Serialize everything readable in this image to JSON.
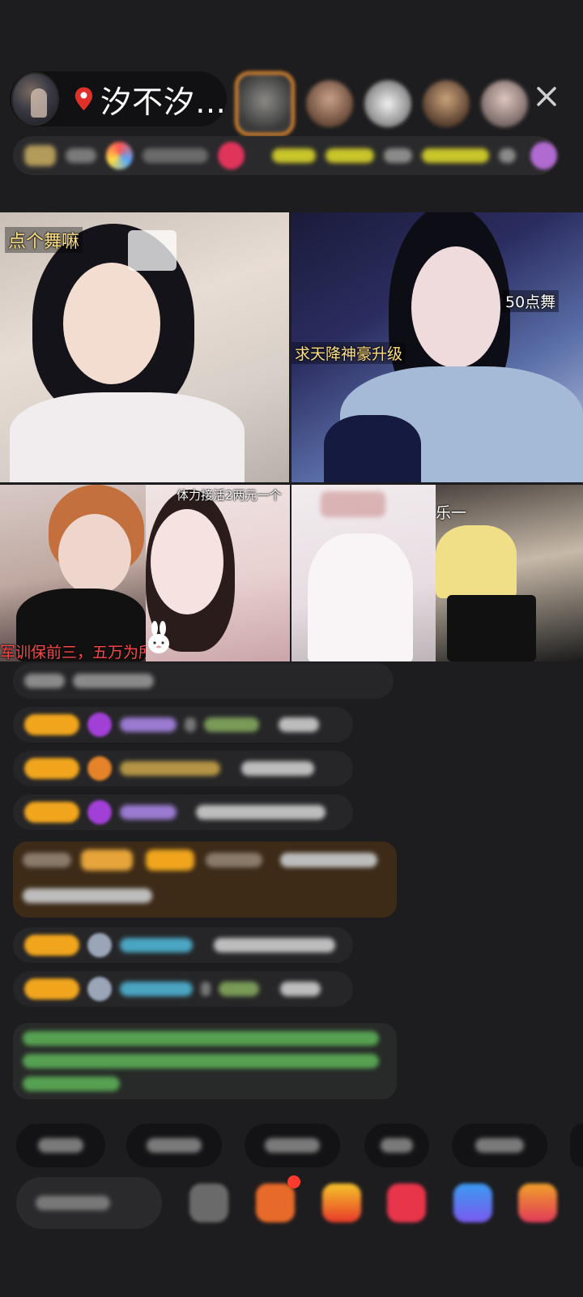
{
  "header": {
    "host_name": "汐不汐…",
    "colors": {
      "pin": "#e0302a",
      "frame": "#e58a2e"
    },
    "icons": [
      "location-pin-icon",
      "close-icon"
    ]
  },
  "video_grid": {
    "tile_1_caption": "点个舞嘛",
    "tile_2_caption_1": "50点舞",
    "tile_2_caption_2": "求天降神豪升级",
    "tile_3_caption": "军训保前三，五万为所",
    "tile_4_caption": "体力接活2两元一个",
    "tile_6_caption": "乐一"
  },
  "colors": {
    "background": "#1d1d1f",
    "badge_gold": "#f0a51c",
    "notice_brown": "#3d2b18",
    "system_green": "#7ee07a"
  }
}
